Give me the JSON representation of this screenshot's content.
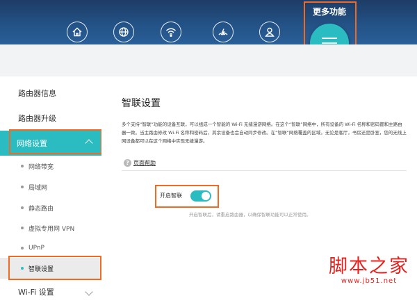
{
  "header": {
    "more_label": "更多功能",
    "nav_icons": [
      "home-icon",
      "globe-icon",
      "wifi-icon",
      "signal-icon",
      "user-icon"
    ],
    "menu_icon": "hamburger-menu-icon"
  },
  "sidebar": {
    "router_info": "路由器信息",
    "router_upgrade": "路由器升级",
    "network_settings": "网络设置",
    "sub_items": [
      "网络带宽",
      "局域网",
      "静态路由",
      "虚拟专用网 VPN",
      "UPnP",
      "智联设置"
    ],
    "wifi_settings": "Wi-Fi 设置"
  },
  "main": {
    "title": "智联设置",
    "description": "多个支持“智联”功能的设备互联，可以组成一个智能的 Wi-Fi 无缝漫游网络。在这个“智联”网络中，所有设备的 Wi-Fi 名称和密码都和主路由器一致。当主路由修改 Wi-Fi 名称和密码后，其余设备也会自动同步修改。在“智联”网络覆盖的区域，无论是客厅，书房还是卧室，您的无线上网设备都可以在这个网络中实现无缝漫游。",
    "help_link": "页面帮助",
    "switch_label": "开启智联",
    "switch_on": true,
    "hint": "开启智联后，请重启路由器，以确保智联功能可以正常使用。"
  },
  "watermark": {
    "title": "脚本之家",
    "url": "www.jb51.net"
  },
  "colors": {
    "header_bg": "#235286",
    "accent": "#2bbcc2",
    "highlight": "#f26a21",
    "watermark": "#e4211d"
  }
}
